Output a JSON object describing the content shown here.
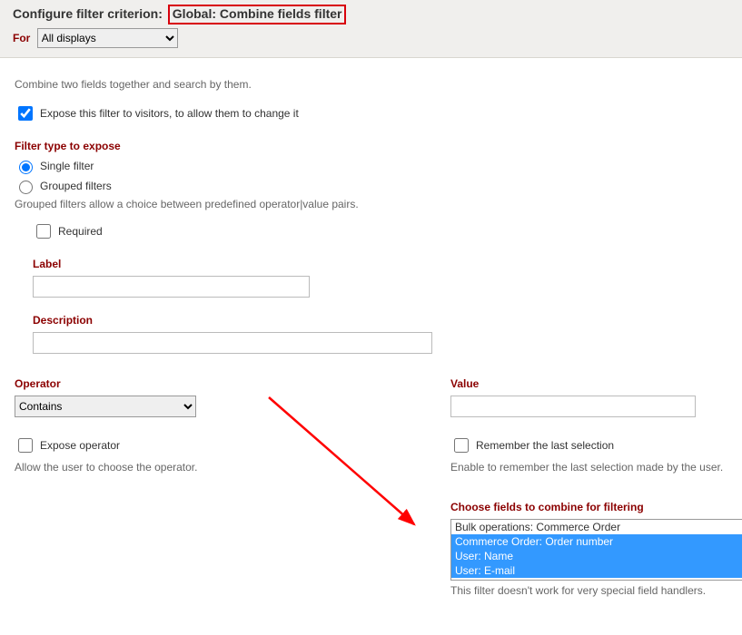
{
  "header": {
    "title_prefix": "Configure filter criterion:",
    "title_highlight": "Global: Combine fields filter",
    "for_label": "For",
    "for_selected": "All displays"
  },
  "intro": "Combine two fields together and search by them.",
  "expose": {
    "checkbox_label": "Expose this filter to visitors, to allow them to change it"
  },
  "filter_type": {
    "heading": "Filter type to expose",
    "single": "Single filter",
    "grouped": "Grouped filters",
    "grouped_help": "Grouped filters allow a choice between predefined operator|value pairs."
  },
  "required_label": "Required",
  "label_heading": "Label",
  "description_heading": "Description",
  "operator": {
    "heading": "Operator",
    "selected": "Contains",
    "expose_label": "Expose operator",
    "expose_help": "Allow the user to choose the operator."
  },
  "value": {
    "heading": "Value",
    "remember_label": "Remember the last selection",
    "remember_help": "Enable to remember the last selection made by the user."
  },
  "choose_fields": {
    "heading": "Choose fields to combine for filtering",
    "options": [
      {
        "label": "Bulk operations: Commerce Order",
        "selected": false
      },
      {
        "label": "Commerce Order: Order number",
        "selected": true
      },
      {
        "label": "User: Name",
        "selected": true
      },
      {
        "label": "User: E-mail",
        "selected": true
      }
    ],
    "help": "This filter doesn't work for very special field handlers."
  }
}
